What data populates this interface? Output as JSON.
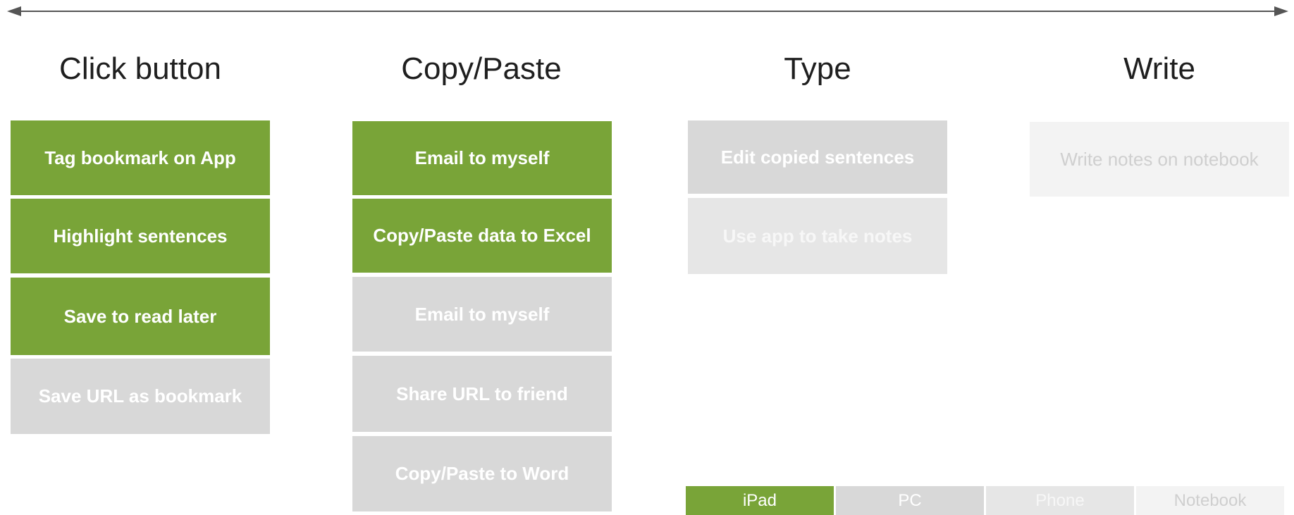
{
  "colors": {
    "green": "#79a438",
    "gray": "#d8d8d8",
    "light_gray": "#e6e6e6",
    "lightest_gray": "#f3f3f3",
    "axis": "#555555"
  },
  "columns": [
    {
      "title": "Click button",
      "cards": [
        {
          "label": "Tag bookmark on App",
          "level": "green"
        },
        {
          "label": "Highlight sentences",
          "level": "green"
        },
        {
          "label": "Save to read later",
          "level": "green"
        },
        {
          "label": "Save URL as bookmark",
          "level": "gray"
        }
      ]
    },
    {
      "title": "Copy/Paste",
      "cards": [
        {
          "label": "Email to myself",
          "level": "green"
        },
        {
          "label": "Copy/Paste data to Excel",
          "level": "green"
        },
        {
          "label": "Email to myself",
          "level": "gray"
        },
        {
          "label": "Share URL to friend",
          "level": "gray"
        },
        {
          "label": "Copy/Paste to Word",
          "level": "gray"
        }
      ]
    },
    {
      "title": "Type",
      "cards": [
        {
          "label": "Edit copied sentences",
          "level": "gray"
        },
        {
          "label": "Use app to take notes",
          "level": "light_gray"
        }
      ]
    },
    {
      "title": "Write",
      "cards": [
        {
          "label": "Write notes on notebook",
          "level": "lightest_gray"
        }
      ]
    }
  ],
  "legend": [
    {
      "label": "iPad",
      "level": "green"
    },
    {
      "label": "PC",
      "level": "gray"
    },
    {
      "label": "Phone",
      "level": "light_gray"
    },
    {
      "label": "Notebook",
      "level": "lightest_gray"
    }
  ]
}
